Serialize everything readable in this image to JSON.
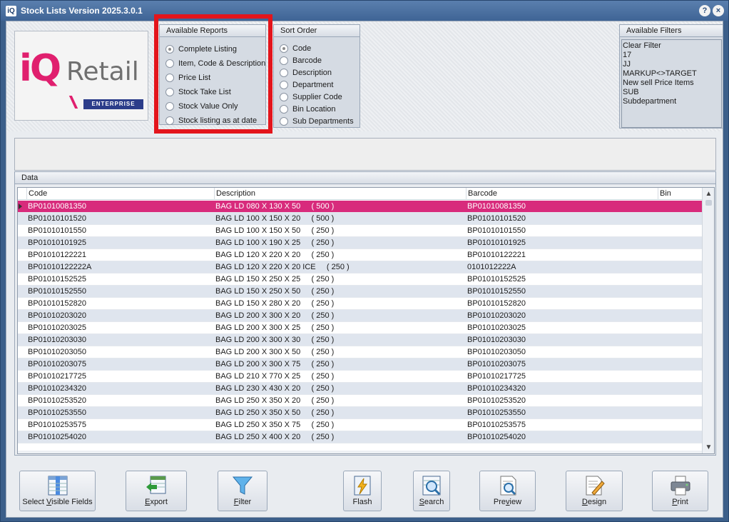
{
  "window": {
    "title": "Stock Lists Version 2025.3.0.1",
    "logo_text": "iQ",
    "help_icon": "?",
    "close_icon": "×"
  },
  "logo": {
    "iq": "iQ",
    "retail": "Retail",
    "edition": "ENTERPRISE"
  },
  "available_reports": {
    "header": "Available Reports",
    "options": [
      {
        "label": "Complete Listing",
        "checked": true
      },
      {
        "label": "Item, Code & Description",
        "checked": false
      },
      {
        "label": "Price List",
        "checked": false
      },
      {
        "label": "Stock Take List",
        "checked": false
      },
      {
        "label": "Stock Value Only",
        "checked": false
      },
      {
        "label": "Stock listing as at date",
        "checked": false
      }
    ]
  },
  "sort_order": {
    "header": "Sort Order",
    "options": [
      {
        "label": "Code",
        "checked": true
      },
      {
        "label": "Barcode",
        "checked": false
      },
      {
        "label": "Description",
        "checked": false
      },
      {
        "label": "Department",
        "checked": false
      },
      {
        "label": "Supplier Code",
        "checked": false
      },
      {
        "label": "Bin Location",
        "checked": false
      },
      {
        "label": "Sub Departments",
        "checked": false
      }
    ]
  },
  "available_filters": {
    "header": "Available Filters",
    "items": [
      "Clear Filter",
      "17",
      "JJ",
      "MARKUP<>TARGET",
      "New sell Price Items",
      "SUB",
      "Subdepartment"
    ]
  },
  "data": {
    "header": "Data",
    "columns": [
      "Code",
      "Description",
      "Barcode",
      "Bin"
    ],
    "rows": [
      [
        "BP01010081350",
        "BAG LD 080 X 130 X 50     ( 500 )",
        "BP01010081350",
        ""
      ],
      [
        "BP01010101520",
        "BAG LD 100 X 150 X 20     ( 500 )",
        "BP01010101520",
        ""
      ],
      [
        "BP01010101550",
        "BAG LD 100 X 150 X 50     ( 250 )",
        "BP01010101550",
        ""
      ],
      [
        "BP01010101925",
        "BAG LD 100 X 190 X 25     ( 250 )",
        "BP01010101925",
        ""
      ],
      [
        "BP01010122221",
        "BAG LD 120 X 220 X 20     ( 250 )",
        "BP01010122221",
        ""
      ],
      [
        "BP01010122222A",
        "BAG LD 120 X 220 X 20 ICE     ( 250 )",
        "0101012222A",
        ""
      ],
      [
        "BP01010152525",
        "BAG LD 150 X 250 X 25     ( 250 )",
        "BP01010152525",
        ""
      ],
      [
        "BP01010152550",
        "BAG LD 150 X 250 X 50     ( 250 )",
        "BP01010152550",
        ""
      ],
      [
        "BP01010152820",
        "BAG LD 150 X 280 X 20     ( 250 )",
        "BP01010152820",
        ""
      ],
      [
        "BP01010203020",
        "BAG LD 200 X 300 X 20     ( 250 )",
        "BP01010203020",
        ""
      ],
      [
        "BP01010203025",
        "BAG LD 200 X 300 X 25     ( 250 )",
        "BP01010203025",
        ""
      ],
      [
        "BP01010203030",
        "BAG LD 200 X 300 X 30     ( 250 )",
        "BP01010203030",
        ""
      ],
      [
        "BP01010203050",
        "BAG LD 200 X 300 X 50     ( 250 )",
        "BP01010203050",
        ""
      ],
      [
        "BP01010203075",
        "BAG LD 200 X 300 X 75     ( 250 )",
        "BP01010203075",
        ""
      ],
      [
        "BP01010217725",
        "BAG LD 210 X 770 X 25     ( 250 )",
        "BP01010217725",
        ""
      ],
      [
        "BP01010234320",
        "BAG LD 230 X 430 X 20     ( 250 )",
        "BP01010234320",
        ""
      ],
      [
        "BP01010253520",
        "BAG LD 250 X 350 X 20     ( 250 )",
        "BP01010253520",
        ""
      ],
      [
        "BP01010253550",
        "BAG LD 250 X 350 X 50     ( 250 )",
        "BP01010253550",
        ""
      ],
      [
        "BP01010253575",
        "BAG LD 250 X 350 X 75     ( 250 )",
        "BP01010253575",
        ""
      ],
      [
        "BP01010254020",
        "BAG LD 250 X 400 X 20     ( 250 )",
        "BP01010254020",
        ""
      ]
    ],
    "selected_row": 0
  },
  "toolbar": {
    "buttons": [
      {
        "name": "select-visible-fields-button",
        "icon": "columns-icon",
        "pre": "Select ",
        "u": "V",
        "post": "isible Fields"
      },
      {
        "name": "export-button",
        "icon": "export-icon",
        "pre": "",
        "u": "E",
        "post": "xport"
      },
      {
        "name": "filter-button",
        "icon": "funnel-icon",
        "pre": "",
        "u": "F",
        "post": "ilter"
      },
      {
        "name": "flash-button",
        "icon": "flash-icon",
        "pre": "Flash",
        "u": "",
        "post": ""
      },
      {
        "name": "search-button",
        "icon": "search-icon",
        "pre": "",
        "u": "S",
        "post": "earch"
      },
      {
        "name": "preview-button",
        "icon": "preview-icon",
        "pre": "Pre",
        "u": "v",
        "post": "iew"
      },
      {
        "name": "design-button",
        "icon": "design-icon",
        "pre": "",
        "u": "D",
        "post": "esign"
      },
      {
        "name": "print-button",
        "icon": "printer-icon",
        "pre": "",
        "u": "P",
        "post": "rint"
      }
    ]
  }
}
